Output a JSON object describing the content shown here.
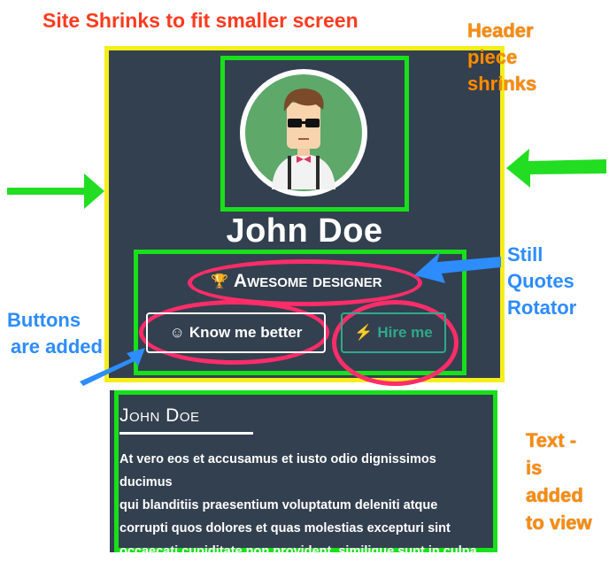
{
  "annotations": {
    "title": "Site Shrinks to fit smaller screen",
    "header": [
      "Header",
      "piece",
      "shrinks"
    ],
    "quotes": [
      "Still",
      "Quotes",
      "Rotator"
    ],
    "buttons": [
      "Buttons",
      "are added"
    ],
    "text": [
      "Text -",
      "is",
      "added",
      "to view"
    ]
  },
  "site": {
    "name": "John Doe",
    "tagline": "Awesome designer",
    "tagline_icon": "trophy-icon",
    "buttons": {
      "know_me": "Know me better",
      "know_me_icon": "smiley-icon",
      "hire_me": "Hire me",
      "hire_me_icon": "lightning-icon"
    },
    "about": {
      "title": "John Doe",
      "lines": [
        "At vero eos et accusamus et iusto odio dignissimos ducimus",
        "qui blanditiis praesentium voluptatum deleniti atque",
        "corrupti quos dolores et quas molestias excepturi sint",
        "occaecati cupiditate non provident, similique sunt in culpa"
      ]
    }
  },
  "colors": {
    "panel": "#33404f",
    "yellow_box": "#f5ee1a",
    "green_box": "#18e01a",
    "pink_ellipse": "#ff2c6a",
    "arrow_green": "#22dd22",
    "arrow_blue": "#2d8cff",
    "teal_button": "#2fa98a"
  }
}
